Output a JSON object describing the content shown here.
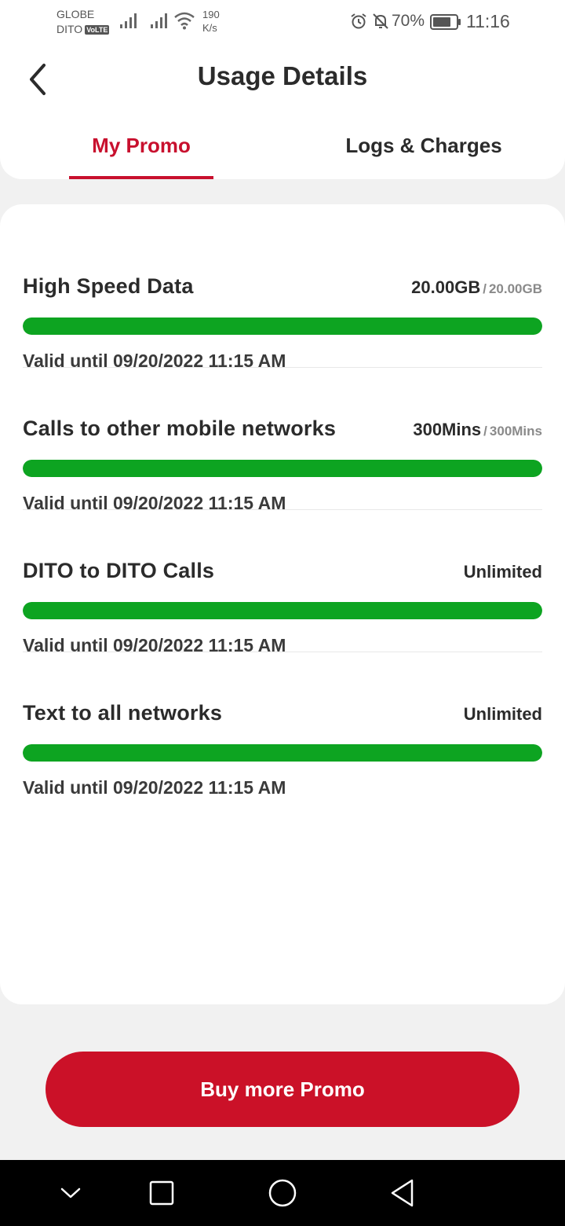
{
  "status_bar": {
    "carrier_1": "GLOBE",
    "carrier_2": "DITO",
    "volte_badge": "VoLTE",
    "net_speed_value": "190",
    "net_speed_unit": "K/s",
    "battery": "70%",
    "time": "11:16"
  },
  "header": {
    "title": "Usage Details",
    "tabs": [
      {
        "label": "My Promo",
        "active": true
      },
      {
        "label": "Logs & Charges",
        "active": false
      }
    ]
  },
  "usage": [
    {
      "name": "High Speed Data",
      "remaining": "20.00GB",
      "total": "20.00GB",
      "fill": 1.0,
      "valid": "Valid until 09/20/2022 11:15 AM"
    },
    {
      "name": "Calls to other mobile networks",
      "remaining": "300Mins",
      "total": "300Mins",
      "fill": 1.0,
      "valid": "Valid until 09/20/2022 11:15 AM"
    },
    {
      "name": "DITO to DITO Calls",
      "remaining": "Unlimited",
      "total": null,
      "fill": 1.0,
      "valid": "Valid until 09/20/2022 11:15 AM"
    },
    {
      "name": "Text to all networks",
      "remaining": "Unlimited",
      "total": null,
      "fill": 1.0,
      "valid": "Valid until 09/20/2022 11:15 AM"
    }
  ],
  "cta": {
    "label": "Buy more Promo"
  },
  "colors": {
    "accent": "#c8102e",
    "bar": "#0da421"
  }
}
